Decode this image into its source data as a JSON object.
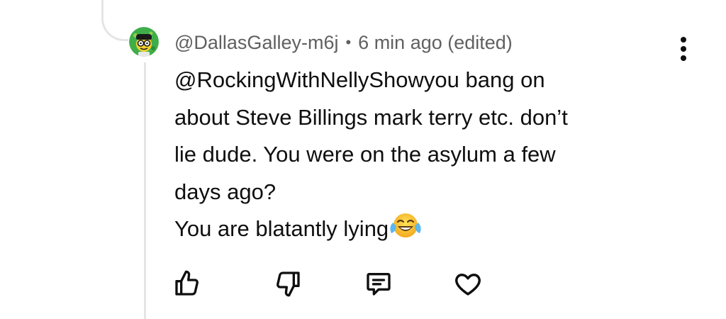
{
  "comment": {
    "author": "@DallasGalley-m6j",
    "separator": "•",
    "time": "6 min ago (edited)",
    "lines": [
      "@RockingWithNellyShowyou bang on",
      "about Steve Billings mark terry etc. don’t",
      "lie dude. You were on the asylum a few",
      "days ago?",
      "You are blatantly lying"
    ],
    "trailing_emoji": "face-with-tears-of-joy-emoji"
  },
  "actions": {
    "like_icon": "thumbs-up-icon",
    "dislike_icon": "thumbs-down-icon",
    "reply_icon": "comment-icon",
    "heart_icon": "heart-icon"
  },
  "menu_icon": "more-vertical-icon"
}
